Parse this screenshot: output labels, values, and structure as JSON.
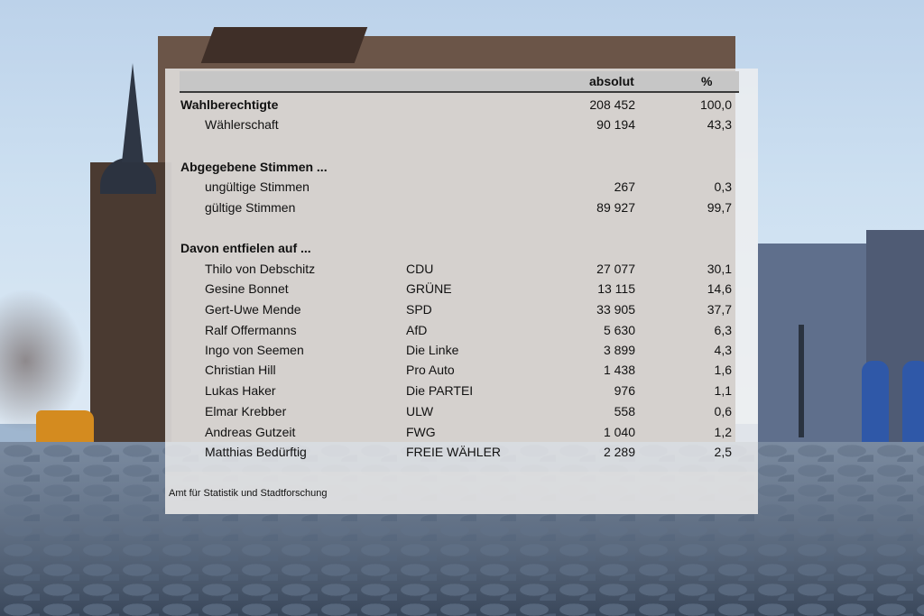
{
  "table": {
    "headers": {
      "absolut": "absolut",
      "percent": "%"
    },
    "wahlberechtigte": {
      "label": "Wahlberechtigte",
      "absolut": "208 452",
      "percent": "100,0"
    },
    "waehlerschaft": {
      "label": "Wählerschaft",
      "absolut": "90 194",
      "percent": "43,3"
    },
    "abgegebene": {
      "label": "Abgegebene Stimmen ..."
    },
    "ungueltige": {
      "label": "ungültige Stimmen",
      "absolut": "267",
      "percent": "0,3"
    },
    "gueltige": {
      "label": "gültige Stimmen",
      "absolut": "89 927",
      "percent": "99,7"
    },
    "davon": {
      "label": "Davon entfielen auf ..."
    },
    "candidates": [
      {
        "name": "Thilo von Debschitz",
        "party": "CDU",
        "absolut": "27 077",
        "percent": "30,1"
      },
      {
        "name": "Gesine Bonnet",
        "party": "GRÜNE",
        "absolut": "13 115",
        "percent": "14,6"
      },
      {
        "name": "Gert-Uwe Mende",
        "party": "SPD",
        "absolut": "33 905",
        "percent": "37,7"
      },
      {
        "name": "Ralf Offermanns",
        "party": "AfD",
        "absolut": "5 630",
        "percent": "6,3"
      },
      {
        "name": "Ingo von Seemen",
        "party": "Die Linke",
        "absolut": "3 899",
        "percent": "4,3"
      },
      {
        "name": "Christian Hill",
        "party": "Pro Auto",
        "absolut": "1 438",
        "percent": "1,6"
      },
      {
        "name": "Lukas Haker",
        "party": "Die PARTEI",
        "absolut": "976",
        "percent": "1,1"
      },
      {
        "name": "Elmar Krebber",
        "party": "ULW",
        "absolut": "558",
        "percent": "0,6"
      },
      {
        "name": "Andreas Gutzeit",
        "party": "FWG",
        "absolut": "1 040",
        "percent": "1,2"
      },
      {
        "name": "Matthias Bedürftig",
        "party": "FREIE WÄHLER",
        "absolut": "2 289",
        "percent": "2,5"
      }
    ]
  },
  "source": "Amt für Statistik und Stadtforschung"
}
